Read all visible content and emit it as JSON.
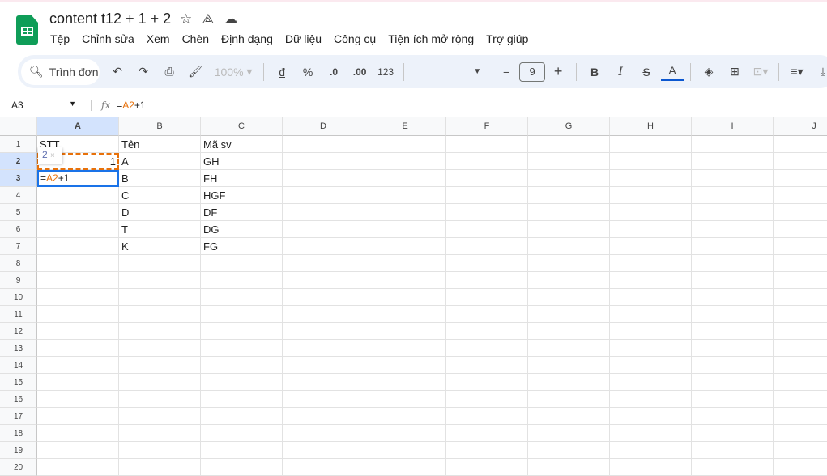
{
  "app": {
    "title": "content t12 + 1 + 2",
    "menu": [
      "Tệp",
      "Chỉnh sửa",
      "Xem",
      "Chèn",
      "Định dạng",
      "Dữ liệu",
      "Công cụ",
      "Tiện ích mở rộng",
      "Trợ giúp"
    ]
  },
  "toolbar": {
    "search": "Trình đơn",
    "zoom": "100%",
    "currency": "đ",
    "percent": "%",
    "dec_decrease": ".0",
    "dec_increase": ".00",
    "number_format": "123",
    "font_size": "9",
    "bold": "B",
    "italic": "I",
    "text_color": "A",
    "text_color_value": "#0b57d0"
  },
  "formula_bar": {
    "name_box": "A3",
    "fx": "fx",
    "formula_ref": "A2",
    "formula_prefix": "=",
    "formula_suffix": "+1"
  },
  "columns": [
    "A",
    "B",
    "C",
    "D",
    "E",
    "F",
    "G",
    "H",
    "I",
    "J"
  ],
  "rows": [
    "1",
    "2",
    "3",
    "4",
    "5",
    "6",
    "7",
    "8",
    "9",
    "10",
    "11",
    "12",
    "13",
    "14",
    "15",
    "16",
    "17",
    "18",
    "19",
    "20"
  ],
  "cells": {
    "A1": "STT",
    "A2": "1",
    "B1": "Tên",
    "B2": "A",
    "B3": "B",
    "B4": "C",
    "B5": "D",
    "B6": "T",
    "B7": "K",
    "C1": "Mã sv",
    "C2": "GH",
    "C3": "FH",
    "C4": "HGF",
    "C5": "DF",
    "C6": "DG",
    "C7": "FG"
  },
  "editor": {
    "tooltip_value": "2",
    "tooltip_close": "×"
  }
}
